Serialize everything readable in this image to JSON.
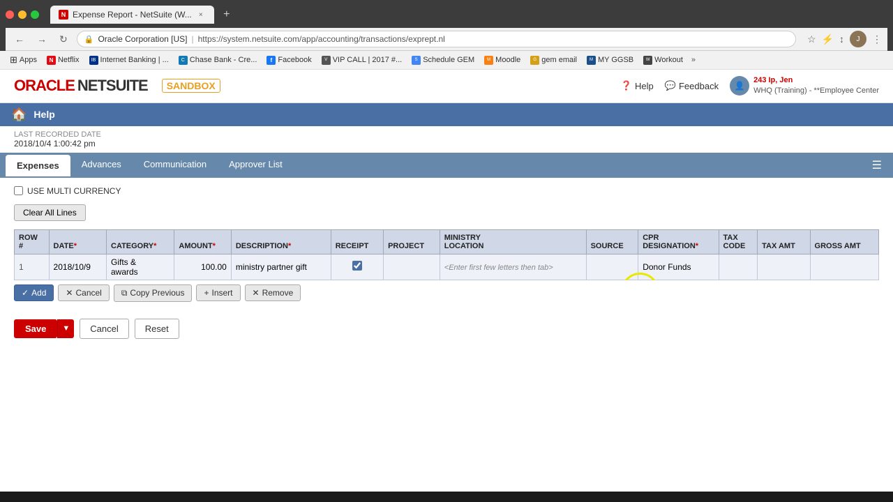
{
  "browser": {
    "tab_title": "Expense Report - NetSuite (W...",
    "tab_favicon": "N",
    "address_lock": "🔒",
    "address_company": "Oracle Corporation [US]",
    "address_separator": " | ",
    "address_url": "https://system.netsuite.com/app/accounting/transactions/exprept.nl",
    "nav_back": "←",
    "nav_forward": "→",
    "nav_refresh": "↻",
    "new_tab": "+",
    "tab_close": "×"
  },
  "bookmarks": [
    {
      "id": "apps",
      "label": "Apps",
      "icon_type": "grid"
    },
    {
      "id": "netflix",
      "label": "Netflix",
      "icon_type": "netflix"
    },
    {
      "id": "internet-banking",
      "label": "Internet Banking | ...",
      "icon_type": "ib"
    },
    {
      "id": "chase-bank",
      "label": "Chase Bank - Cre...",
      "icon_type": "chase"
    },
    {
      "id": "facebook",
      "label": "Facebook",
      "icon_type": "fb"
    },
    {
      "id": "vip-call",
      "label": "VIP CALL | 2017 #...",
      "icon_type": "vip"
    },
    {
      "id": "schedule-gem",
      "label": "Schedule GEM",
      "icon_type": "sched"
    },
    {
      "id": "moodle",
      "label": "Moodle",
      "icon_type": "moodle"
    },
    {
      "id": "gem-email",
      "label": "gem email",
      "icon_type": "gem"
    },
    {
      "id": "my-ggsb",
      "label": "MY GGSB",
      "icon_type": "myggsb"
    },
    {
      "id": "workout",
      "label": "Workout",
      "icon_type": "workout"
    }
  ],
  "netsuite": {
    "oracle_text": "ORACLE",
    "netsuite_text": "NETSUITE",
    "sandbox_text": "SANDBOX",
    "help_label": "Help",
    "feedback_label": "Feedback",
    "user_name": "243 Ip, Jen",
    "user_org": "WHQ (Training) - **Employee Center",
    "helpbar_label": "Help"
  },
  "dateinfo": {
    "label1": "LAST RECORDED DATE",
    "date": "2018/10/4 1:00:42 pm"
  },
  "tabs": [
    {
      "id": "expenses",
      "label": "Expenses",
      "active": true
    },
    {
      "id": "advances",
      "label": "Advances",
      "active": false
    },
    {
      "id": "communication",
      "label": "Communication",
      "active": false
    },
    {
      "id": "approver-list",
      "label": "Approver List",
      "active": false
    }
  ],
  "content": {
    "multi_currency_label": "USE MULTI CURRENCY",
    "clear_all_lines_label": "Clear All Lines"
  },
  "table": {
    "headers": [
      {
        "id": "row-num",
        "label": "ROW #"
      },
      {
        "id": "date",
        "label": "DATE",
        "required": true
      },
      {
        "id": "category",
        "label": "CATEGORY",
        "required": true
      },
      {
        "id": "amount",
        "label": "AMOUNT",
        "required": true
      },
      {
        "id": "description",
        "label": "DESCRIPTION",
        "required": true
      },
      {
        "id": "receipt",
        "label": "RECEIPT"
      },
      {
        "id": "project",
        "label": "PROJECT"
      },
      {
        "id": "ministry-location",
        "label": "MINISTRY LOCATION"
      },
      {
        "id": "source",
        "label": "SOURCE"
      },
      {
        "id": "cpr-designation",
        "label": "CPR DESIGNATION",
        "required": true
      },
      {
        "id": "tax-code",
        "label": "TAX CODE"
      },
      {
        "id": "tax-amt",
        "label": "TAX AMT"
      },
      {
        "id": "gross-amt",
        "label": "GROSS AMT"
      }
    ],
    "rows": [
      {
        "row_num": "1",
        "date": "2018/10/9",
        "category_line1": "Gifts &",
        "category_line2": "awards",
        "amount": "100.00",
        "description": "ministry partner gift",
        "receipt_checked": true,
        "project": "",
        "ministry_location_hint": "<Enter first few letters then tab>",
        "source": "",
        "cpr_designation": "Donor Funds",
        "tax_code": "",
        "tax_amt": "",
        "gross_amt": ""
      }
    ]
  },
  "action_buttons": [
    {
      "id": "add",
      "label": "Add",
      "icon": "✓",
      "style": "blue"
    },
    {
      "id": "cancel",
      "label": "Cancel",
      "icon": "✕",
      "style": "gray"
    },
    {
      "id": "copy-previous",
      "label": "Copy Previous",
      "icon": "⧉",
      "style": "gray"
    },
    {
      "id": "insert",
      "label": "Insert",
      "icon": "+",
      "style": "gray"
    },
    {
      "id": "remove",
      "label": "Remove",
      "icon": "✕",
      "style": "gray"
    }
  ],
  "bottom_buttons": [
    {
      "id": "save",
      "label": "Save",
      "style": "red"
    },
    {
      "id": "cancel",
      "label": "Cancel",
      "style": "outline"
    },
    {
      "id": "reset",
      "label": "Reset",
      "style": "outline"
    }
  ]
}
